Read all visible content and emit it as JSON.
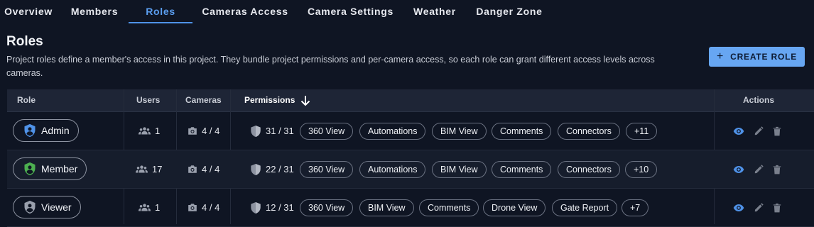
{
  "tabs": [
    {
      "label": "Overview"
    },
    {
      "label": "Members"
    },
    {
      "label": "Roles"
    },
    {
      "label": "Cameras Access"
    },
    {
      "label": "Camera Settings"
    },
    {
      "label": "Weather"
    },
    {
      "label": "Danger Zone"
    }
  ],
  "active_tab": "Roles",
  "page": {
    "title": "Roles",
    "description": "Project roles define a member's access in this project. They bundle project permissions and per-camera access, so each role can grant different access levels across cameras.",
    "create_button": "CREATE ROLE"
  },
  "table": {
    "headers": {
      "role": "Role",
      "users": "Users",
      "cameras": "Cameras",
      "permissions": "Permissions",
      "actions": "Actions"
    },
    "sort": {
      "column": "Permissions",
      "direction": "descending"
    },
    "rows": [
      {
        "role": "Admin",
        "icon_color": "#4f92e8",
        "users": "1",
        "cameras": "4 / 4",
        "permissions": "31 / 31",
        "chips": [
          "360 View",
          "Automations",
          "BIM View",
          "Comments",
          "Connectors",
          "+11"
        ]
      },
      {
        "role": "Member",
        "icon_color": "#4caf50",
        "users": "17",
        "cameras": "4 / 4",
        "permissions": "22 / 31",
        "chips": [
          "360 View",
          "Automations",
          "BIM View",
          "Comments",
          "Connectors",
          "+10"
        ]
      },
      {
        "role": "Viewer",
        "icon_color": "#9aa0ad",
        "users": "1",
        "cameras": "4 / 4",
        "permissions": "12 / 31",
        "chips": [
          "360 View",
          "BIM View",
          "Comments",
          "Drone View",
          "Gate Report",
          "+7"
        ]
      }
    ]
  },
  "colors": {
    "accent": "#5b9ef0",
    "background": "#0f1523",
    "view_icon": "#4f92e8",
    "muted_icon": "#7a808d"
  },
  "icons": {
    "users": "group-icon",
    "cameras": "camera-icon",
    "permissions": "shield-icon",
    "view": "eye-icon",
    "edit": "pencil-icon",
    "delete": "trash-icon",
    "sort": "arrow-down-icon",
    "create": "plus-icon"
  }
}
